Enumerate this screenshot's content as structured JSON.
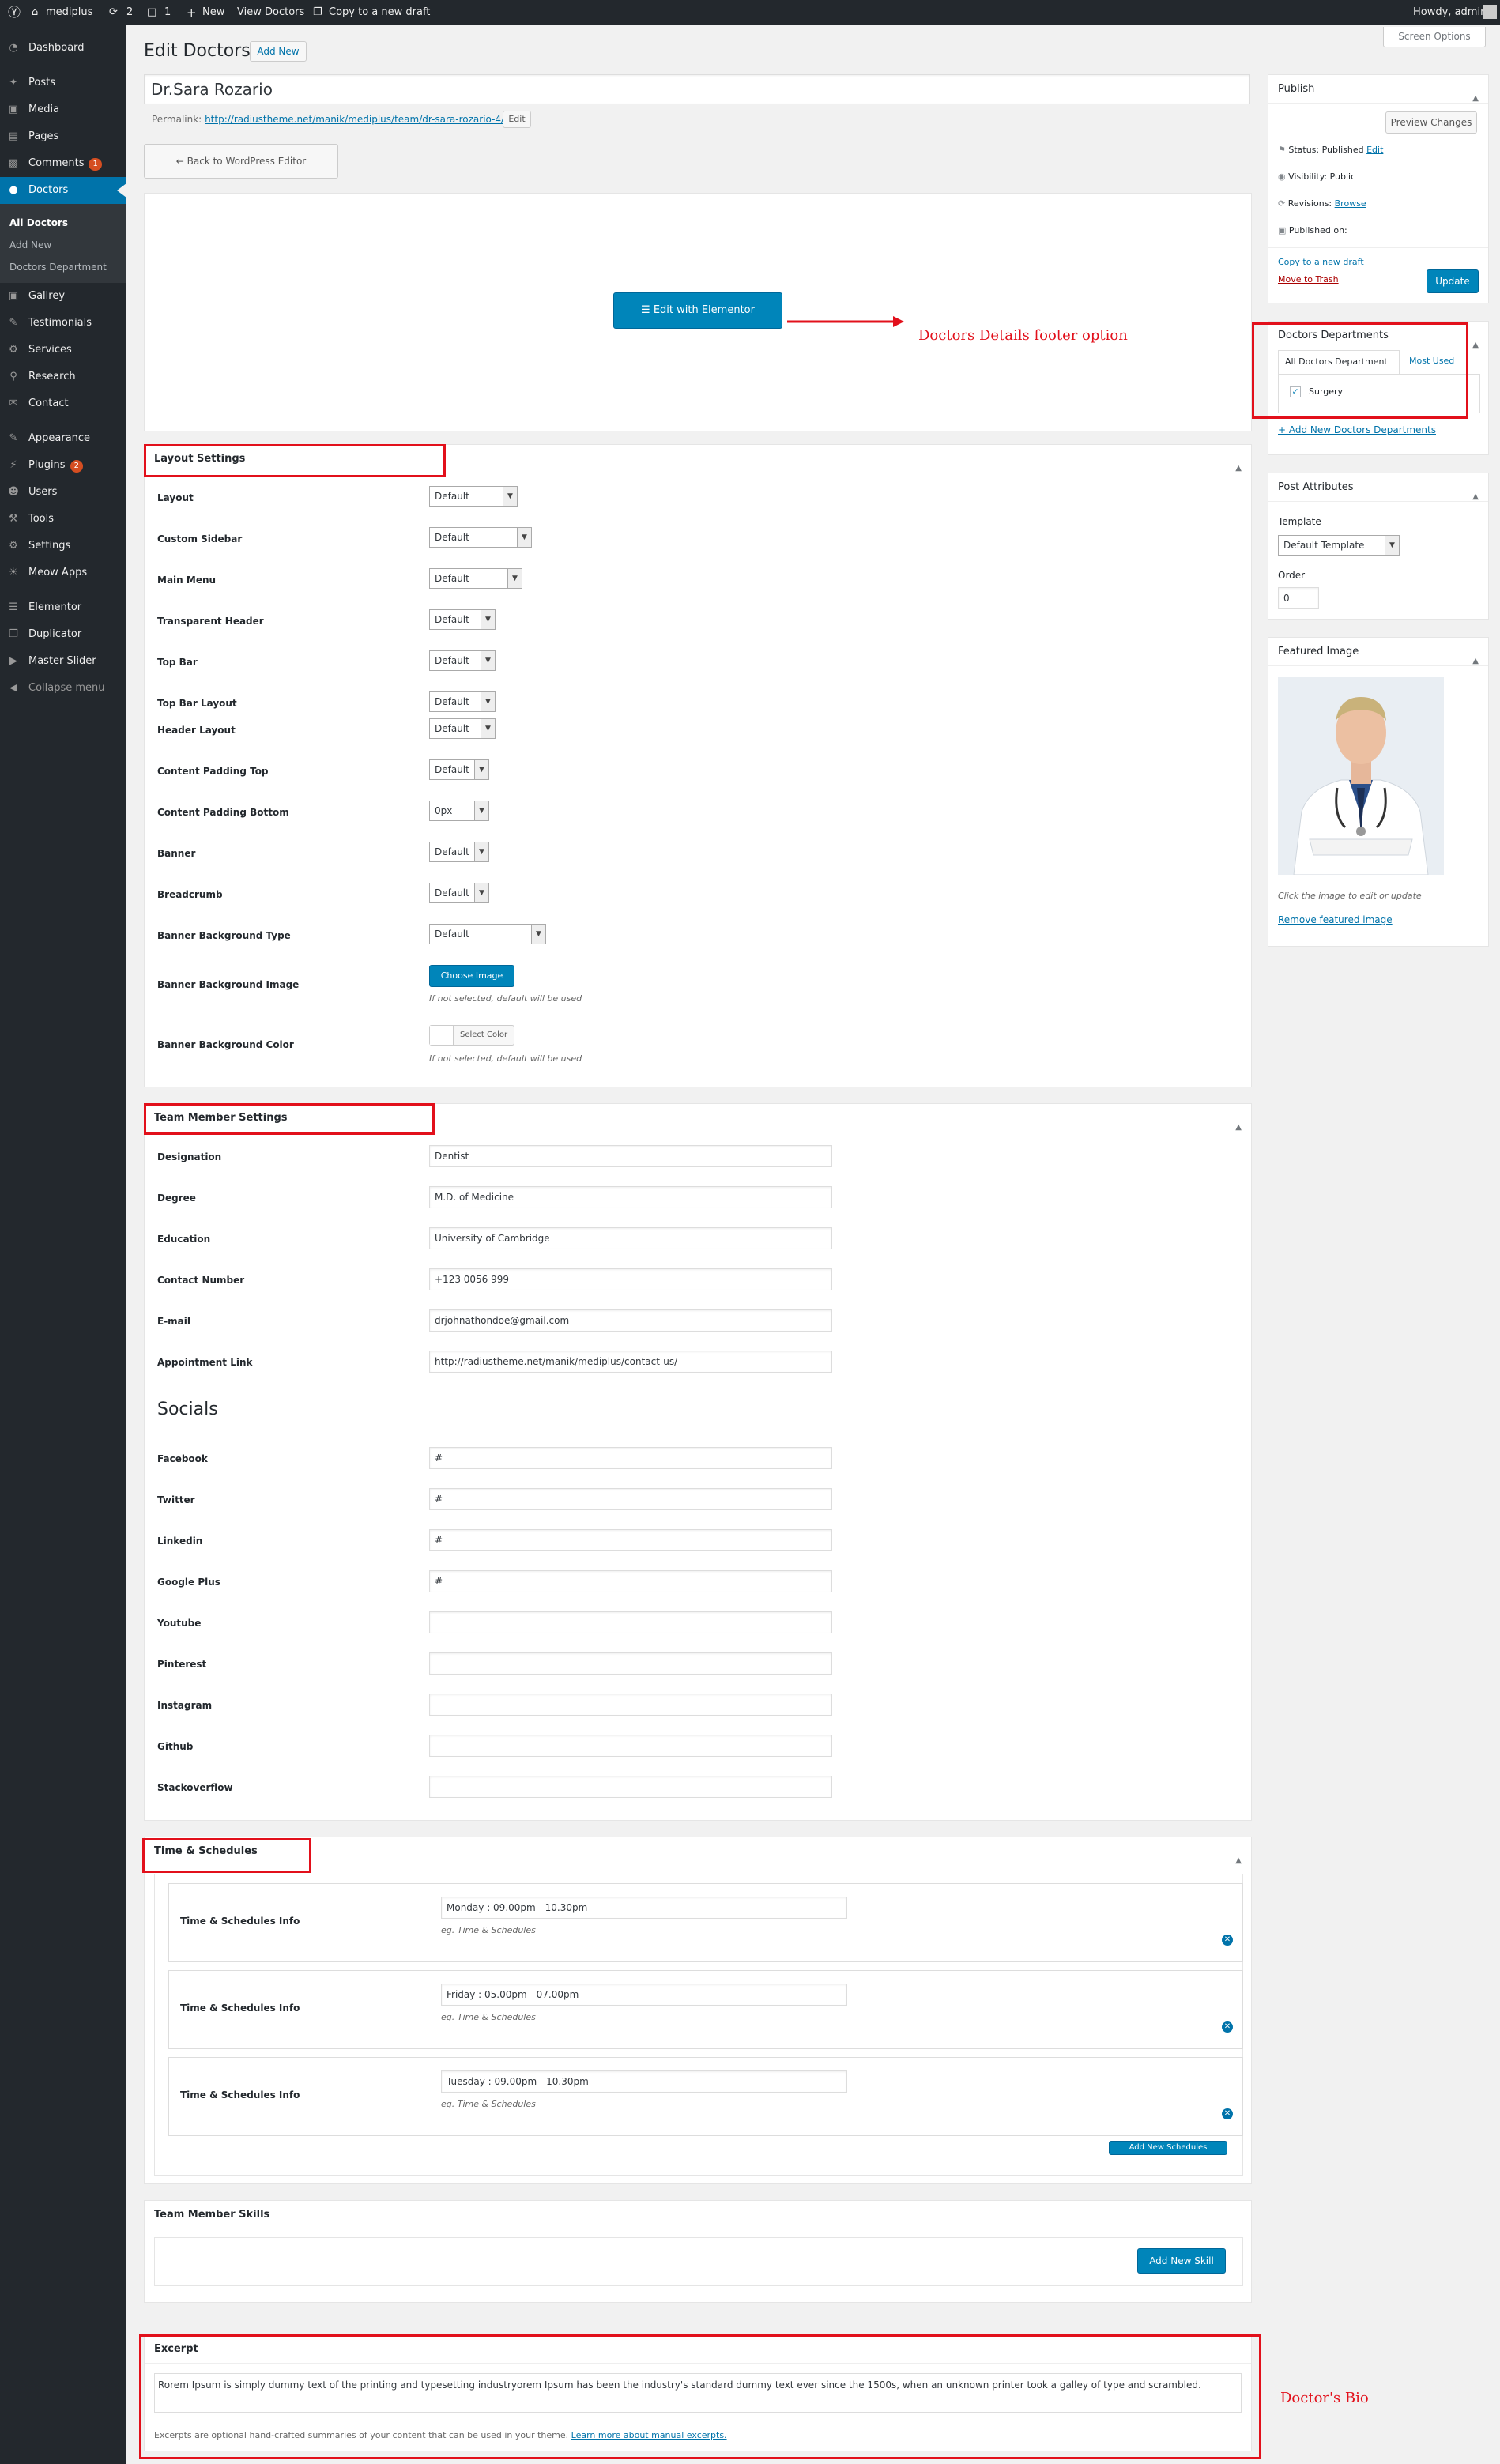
{
  "adminbar": {
    "site": "mediplus",
    "updates": "2",
    "comments": "1",
    "new": "New",
    "view": "View Doctors",
    "copy": "Copy to a new draft",
    "howdy": "Howdy, admin"
  },
  "menu": {
    "items": [
      {
        "label": "Dashboard",
        "icon": "dashboard-icon"
      },
      {
        "label": "Posts",
        "icon": "pin-icon"
      },
      {
        "label": "Media",
        "icon": "media-icon"
      },
      {
        "label": "Pages",
        "icon": "page-icon"
      },
      {
        "label": "Comments",
        "icon": "comment-icon",
        "badge": "1"
      },
      {
        "label": "Doctors",
        "icon": "doctor-icon"
      },
      {
        "label": "Gallrey",
        "icon": "gallery-icon"
      },
      {
        "label": "Testimonials",
        "icon": "testimonial-icon"
      },
      {
        "label": "Services",
        "icon": "services-icon"
      },
      {
        "label": "Research",
        "icon": "research-icon"
      },
      {
        "label": "Contact",
        "icon": "contact-icon"
      },
      {
        "label": "Appearance",
        "icon": "appearance-icon"
      },
      {
        "label": "Plugins",
        "icon": "plugin-icon",
        "badge": "2"
      },
      {
        "label": "Users",
        "icon": "users-icon"
      },
      {
        "label": "Tools",
        "icon": "tools-icon"
      },
      {
        "label": "Settings",
        "icon": "settings-icon"
      },
      {
        "label": "Meow Apps",
        "icon": "meow-icon"
      },
      {
        "label": "Elementor",
        "icon": "elementor-icon"
      },
      {
        "label": "Duplicator",
        "icon": "duplicator-icon"
      },
      {
        "label": "Master Slider",
        "icon": "slider-icon"
      },
      {
        "label": "Collapse menu",
        "icon": "collapse-icon"
      }
    ],
    "sub": [
      "All Doctors",
      "Add New",
      "Doctors Department"
    ]
  },
  "header": {
    "title": "Edit Doctors",
    "add_new": "Add New",
    "screen_options": "Screen Options"
  },
  "post": {
    "title": "Dr.Sara Rozario",
    "permalink_label": "Permalink:",
    "permalink": "http://radiustheme.net/manik/mediplus/team/dr-sara-rozario-4/",
    "edit": "Edit",
    "back": "Back to WordPress Editor",
    "elementor": "Edit with Elementor"
  },
  "annotations": {
    "footer": "Doctors Details footer option",
    "bio": "Doctor's Bio"
  },
  "layout": {
    "title": "Layout Settings",
    "rows": [
      {
        "label": "Layout",
        "value": "Default"
      },
      {
        "label": "Custom Sidebar",
        "value": "Default"
      },
      {
        "label": "Main Menu",
        "value": "Default"
      },
      {
        "label": "Transparent Header",
        "value": "Default"
      },
      {
        "label": "Top Bar",
        "value": "Default"
      },
      {
        "label": "Top Bar Layout",
        "value": "Default"
      },
      {
        "label": "Header Layout",
        "value": "Default"
      },
      {
        "label": "Content Padding Top",
        "value": "Default"
      },
      {
        "label": "Content Padding Bottom",
        "value": "0px"
      },
      {
        "label": "Banner",
        "value": "Default"
      },
      {
        "label": "Breadcrumb",
        "value": "Default"
      },
      {
        "label": "Banner Background Type",
        "value": "Default"
      }
    ],
    "bg_image_label": "Banner Background Image",
    "choose_image": "Choose Image",
    "bg_color_label": "Banner Background Color",
    "select_color": "Select Color",
    "hint": "If not selected, default will be used"
  },
  "team": {
    "title": "Team Member Settings",
    "fields": [
      {
        "label": "Designation",
        "value": "Dentist"
      },
      {
        "label": "Degree",
        "value": "M.D. of Medicine"
      },
      {
        "label": "Education",
        "value": "University of Cambridge"
      },
      {
        "label": "Contact Number",
        "value": "+123 0056 999"
      },
      {
        "label": "E-mail",
        "value": "drjohnathondoe@gmail.com"
      },
      {
        "label": "Appointment Link",
        "value": "http://radiustheme.net/manik/mediplus/contact-us/"
      }
    ],
    "socials_heading": "Socials",
    "socials": [
      {
        "label": "Facebook",
        "value": "#"
      },
      {
        "label": "Twitter",
        "value": "#"
      },
      {
        "label": "Linkedin",
        "value": "#"
      },
      {
        "label": "Google Plus",
        "value": "#"
      },
      {
        "label": "Youtube",
        "value": ""
      },
      {
        "label": "Pinterest",
        "value": ""
      },
      {
        "label": "Instagram",
        "value": ""
      },
      {
        "label": "Github",
        "value": ""
      },
      {
        "label": "Stackoverflow",
        "value": ""
      }
    ]
  },
  "schedules": {
    "title": "Time & Schedules",
    "items": [
      {
        "label": "Time & Schedules Info",
        "value": "Monday : 09.00pm - 10.30pm",
        "hint": "eg. Time & Schedules"
      },
      {
        "label": "Time & Schedules Info",
        "value": "Friday : 05.00pm - 07.00pm",
        "hint": "eg. Time & Schedules"
      },
      {
        "label": "Time & Schedules Info",
        "value": "Tuesday : 09.00pm - 10.30pm",
        "hint": "eg. Time & Schedules"
      }
    ],
    "add": "Add New Schedules"
  },
  "skills": {
    "title": "Team Member Skills",
    "add": "Add New Skill"
  },
  "excerpt": {
    "title": "Excerpt",
    "text": "Rorem Ipsum is simply dummy text of the printing and typesetting industryorem Ipsum has been the industry's standard dummy text ever since the 1500s, when an unknown printer took a galley of type and scrambled.",
    "note": "Excerpts are optional hand-crafted summaries of your content that can be used in your theme.",
    "learn": "Learn more about manual excerpts."
  },
  "publish": {
    "title": "Publish",
    "preview": "Preview Changes",
    "status": "Status: Published",
    "status_edit": "Edit",
    "visibility": "Visibility: Public",
    "revisions": "Revisions:",
    "browse": "Browse",
    "published_on": "Published on:",
    "copy": "Copy to a new draft",
    "trash": "Move to Trash",
    "update": "Update"
  },
  "departments": {
    "title": "Doctors Departments",
    "tab_all": "All Doctors Department",
    "tab_most": "Most Used",
    "item": "Surgery",
    "add": "+ Add New Doctors Departments"
  },
  "attributes": {
    "title": "Post Attributes",
    "template_label": "Template",
    "template": "Default Template",
    "order_label": "Order",
    "order": "0"
  },
  "featured": {
    "title": "Featured Image",
    "hint": "Click the image to edit or update",
    "remove": "Remove featured image"
  }
}
